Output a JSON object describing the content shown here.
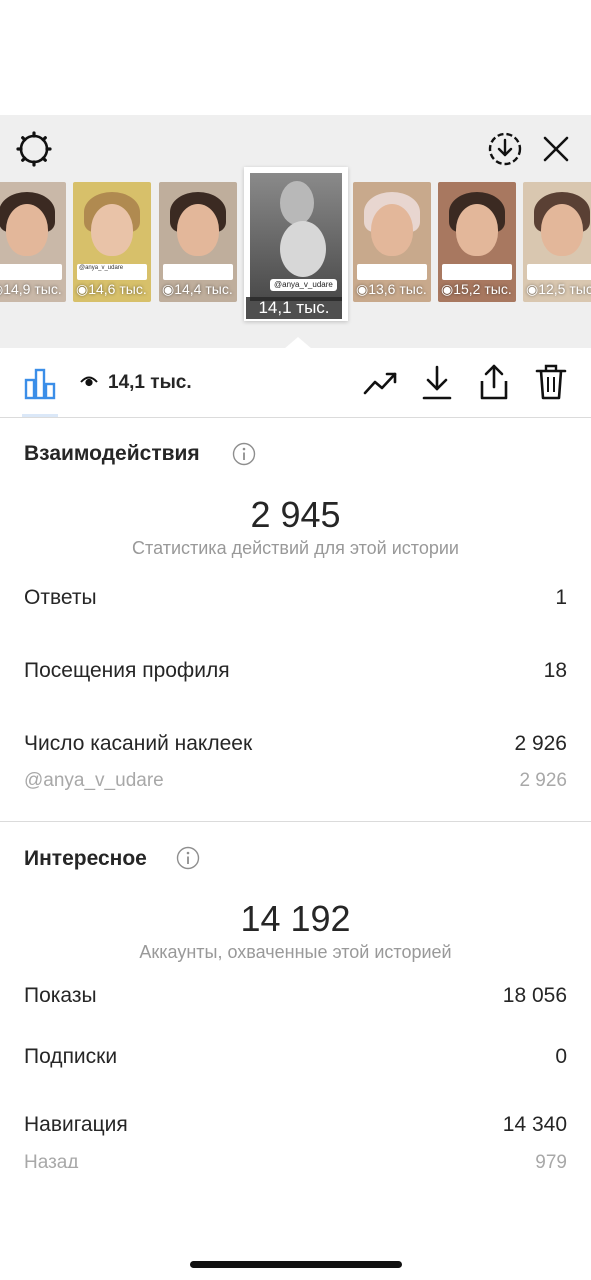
{
  "story_tray": {
    "thumbnails": [
      {
        "views": "14,9 тыс."
      },
      {
        "views": "14,6 тыс.",
        "caption": "@anya_v_udare"
      },
      {
        "views": "14,4 тыс."
      },
      {
        "views": "13,6 тыс."
      },
      {
        "views": "15,2 тыс."
      },
      {
        "views": "12,5 тыс."
      }
    ],
    "active": {
      "views": "14,1 тыс.",
      "tag": "@anya_v_udare"
    }
  },
  "toolbar": {
    "views": "14,1 тыс."
  },
  "interactions": {
    "title": "Взаимодействия",
    "total": "2 945",
    "subtitle": "Статистика действий для этой истории",
    "rows": [
      {
        "label": "Ответы",
        "value": "1"
      },
      {
        "label": "Посещения профиля",
        "value": "18"
      },
      {
        "label": "Число касаний наклеек",
        "value": "2 926"
      }
    ],
    "sticker": {
      "label": "@anya_v_udare",
      "value": "2 926"
    }
  },
  "discovery": {
    "title": "Интересное",
    "total": "14 192",
    "subtitle": "Аккаунты, охваченные этой историей",
    "rows": [
      {
        "label": "Показы",
        "value": "18 056"
      },
      {
        "label": "Подписки",
        "value": "0"
      },
      {
        "label": "Навигация",
        "value": "14 340"
      }
    ],
    "back": {
      "label": "Назад",
      "value": "979"
    }
  }
}
